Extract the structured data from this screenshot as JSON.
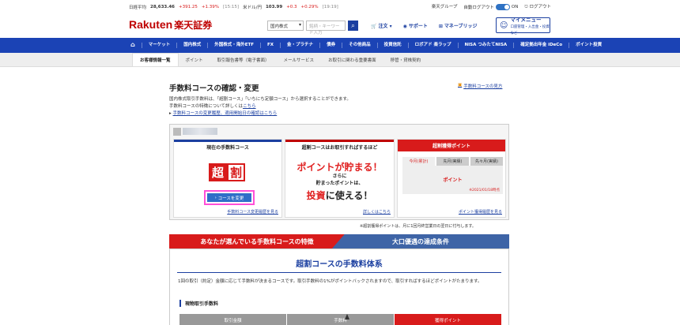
{
  "ticker": {
    "nikkei_label": "日経平均",
    "nikkei_value": "28,633.46",
    "nikkei_change": "+391.25",
    "nikkei_pct": "+1.39%",
    "nikkei_time": "[15:15]",
    "usd_label": "米ドル/円",
    "usd_value": "103.99",
    "usd_change": "+0.3",
    "usd_pct": "+0.29%",
    "usd_time": "[19:19]",
    "group": "楽天グループ",
    "auto_logout": "自動ログアウト",
    "toggle": "ON",
    "logout": "ログアウト"
  },
  "header": {
    "logo_en": "Rakuten",
    "logo_jp": "楽天証券",
    "search_scope": "国内株式",
    "search_placeholder": "銘柄・キーワード入力",
    "order": "注文",
    "support": "サポート",
    "manabi": "マネーブリッジ",
    "mymenu_title": "マイメニュー",
    "mymenu_sub": "口座管理・入出金・投資など"
  },
  "nav": {
    "items": [
      "マーケット",
      "国内株式",
      "外国株式・海外ETF",
      "FX",
      "金・プラチナ",
      "債券",
      "その他商品",
      "投資信託",
      "ロボアド 楽ラップ",
      "NISA つみたてNISA",
      "確定拠出年金 iDeCo",
      "ポイント投資"
    ]
  },
  "subnav": {
    "items": [
      "お客様情報一覧",
      "ポイント",
      "取引報告書等（電子書面）",
      "メールサービス",
      "お取引に関わる重要書面",
      "移管・貸株契約"
    ]
  },
  "page": {
    "title": "手数料コースの確認・変更",
    "guide": "手数料コースの見方",
    "intro1": "国内株式取引手数料は、「超割コース」「いちにち定額コース」から選択することができます。",
    "intro2": "手数料コースの特徴について詳しくは",
    "intro2_link": "こちら",
    "intro3": "手数料コースの変更履歴、適用開始日の確認はこちら"
  },
  "panel": {
    "current_title": "現在の手数料コース",
    "badge1": "超",
    "badge2": "割",
    "change_btn": "コースを変更",
    "current_link": "手数料コース変更履歴を見る",
    "promo_title": "超割コースはお取引すればするほど",
    "promo_big1": "ポイントが貯まる！",
    "promo_mid": "さらに",
    "promo_mid2": "貯まったポイントは、",
    "promo_big2a": "投資",
    "promo_big2b": "に使える！",
    "promo_link": "詳しくはこちら",
    "points_title": "超割獲得ポイント",
    "tabs": [
      "今月(累計)",
      "先月(実績)",
      "先々月(実績)"
    ],
    "points_value": "ポイント",
    "points_date": "※2021/01/18時点",
    "points_link": "ポイント獲得履歴を見る",
    "note": "※超割獲得ポイントは、月に1回月終営業日の翌日に付与します。"
  },
  "banners": {
    "red": "あなたが選んでいる手数料コースの特徴",
    "blue": "大口優遇の達成条件"
  },
  "plan": {
    "heading": "超割コースの手数料体系",
    "text": "1回の取引（約定）金額に応じて手数料が決まるコースです。取引手数料の1%がポイントバックされますので、取引すればするほどポイントがたまります。",
    "section": "現物取引手数料",
    "col1": "取引金額",
    "col2": "手数料",
    "col3": "獲得ポイント"
  }
}
